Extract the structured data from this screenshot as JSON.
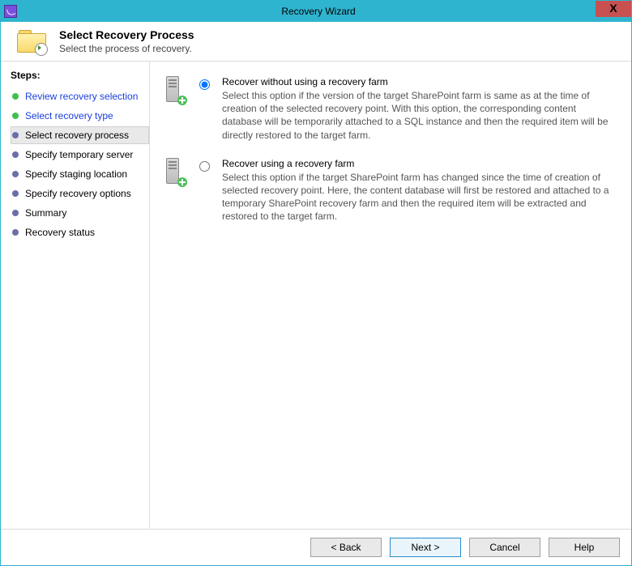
{
  "titlebar": {
    "title": "Recovery Wizard"
  },
  "header": {
    "title": "Select Recovery Process",
    "subtitle": "Select the process of recovery."
  },
  "sidebar": {
    "heading": "Steps:",
    "items": [
      {
        "label": "Review recovery selection",
        "state": "completed"
      },
      {
        "label": "Select recovery type",
        "state": "completed"
      },
      {
        "label": "Select recovery process",
        "state": "current"
      },
      {
        "label": "Specify temporary server",
        "state": "upcoming"
      },
      {
        "label": "Specify staging location",
        "state": "upcoming"
      },
      {
        "label": "Specify recovery options",
        "state": "upcoming"
      },
      {
        "label": "Summary",
        "state": "upcoming"
      },
      {
        "label": "Recovery status",
        "state": "upcoming"
      }
    ]
  },
  "options": [
    {
      "id": "no-farm",
      "selected": true,
      "label": "Recover without using a recovery farm",
      "desc": "Select this option if the version of the target SharePoint farm is same as at the time of creation of the selected recovery point. With this option, the corresponding content database will be temporarily attached to a SQL instance and then the required item will be directly restored to the target farm."
    },
    {
      "id": "use-farm",
      "selected": false,
      "label": "Recover using a recovery farm",
      "desc": "Select this option if the target SharePoint farm has changed since the time of creation of selected recovery point. Here, the content database will first be restored and attached to a temporary SharePoint recovery farm and then the required item will be extracted and restored to the target farm."
    }
  ],
  "footer": {
    "back": "< Back",
    "next": "Next >",
    "cancel": "Cancel",
    "help": "Help"
  }
}
